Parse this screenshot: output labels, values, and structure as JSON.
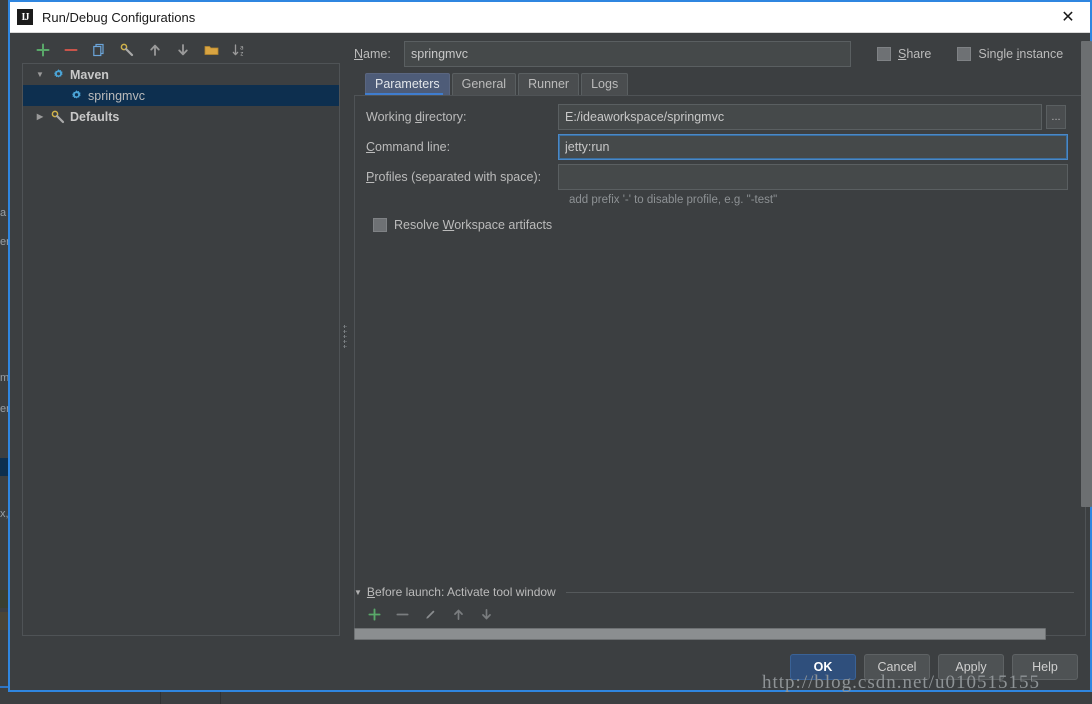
{
  "window": {
    "title": "Run/Debug Configurations",
    "app_icon": "intellij-idea-icon",
    "close_label": "✕"
  },
  "tree_toolbar": {
    "items": [
      {
        "name": "add-configuration-button",
        "icon": "plus-icon",
        "color": "#59a869"
      },
      {
        "name": "remove-configuration-button",
        "icon": "minus-icon",
        "color": "#c9544a"
      },
      {
        "name": "copy-configuration-button",
        "icon": "copy-icon",
        "color": "#6ba4d9"
      },
      {
        "name": "edit-defaults-button",
        "icon": "wrench-icon",
        "color": "#a9a9a9"
      },
      {
        "name": "move-up-button",
        "icon": "arrow-up-icon",
        "color": "#9a9a9a"
      },
      {
        "name": "move-down-button",
        "icon": "arrow-down-icon",
        "color": "#9a9a9a"
      },
      {
        "name": "create-folder-button",
        "icon": "folder-icon",
        "color": "#d9a441"
      },
      {
        "name": "sort-alphabetically-button",
        "icon": "sort-az-icon",
        "color": "#a9a9a9"
      }
    ]
  },
  "tree": {
    "nodes": [
      {
        "label": "Maven",
        "icon": "maven-gear-icon",
        "expanded": true,
        "selected": false,
        "level": 0,
        "arrow": "▼"
      },
      {
        "label": "springmvc",
        "icon": "maven-gear-icon",
        "expanded": false,
        "selected": true,
        "level": 1,
        "arrow": ""
      },
      {
        "label": "Defaults",
        "icon": "wrench-icon",
        "expanded": false,
        "selected": false,
        "level": 0,
        "arrow": "▶"
      }
    ]
  },
  "name_row": {
    "label_prefix": "",
    "label": "Name:",
    "label_mnemonic": "N",
    "label_rest": "ame:",
    "value": "springmvc",
    "share": {
      "label_mnemonic": "S",
      "label_rest": "hare",
      "label": "Share",
      "checked": false
    },
    "single_instance": {
      "label_before": "Single ",
      "label_mnemonic": "i",
      "label_rest": "nstance",
      "label": "Single instance",
      "checked": false
    }
  },
  "tabs": [
    {
      "label": "Parameters",
      "active": true
    },
    {
      "label": "General",
      "active": false
    },
    {
      "label": "Runner",
      "active": false
    },
    {
      "label": "Logs",
      "active": false
    }
  ],
  "parameters_panel": {
    "working_directory": {
      "label_before": "Working ",
      "label_mnemonic": "d",
      "label_rest": "irectory:",
      "label": "Working directory:",
      "value": "E:/ideaworkspace/springmvc",
      "browse_label": "..."
    },
    "command_line": {
      "label_mnemonic": "C",
      "label_rest": "ommand line:",
      "label": "Command line:",
      "value": "jetty:run",
      "focused": true
    },
    "profiles": {
      "label_mnemonic": "P",
      "label_rest": "rofiles (separated with space):",
      "label": "Profiles (separated with space):",
      "value": "",
      "hint": "add prefix '-' to disable profile, e.g. \"-test\""
    },
    "resolve_workspace_artifacts": {
      "label_before": "Resolve ",
      "label_mnemonic": "W",
      "label_rest": "orkspace artifacts",
      "label": "Resolve Workspace artifacts",
      "checked": false
    }
  },
  "before_launch": {
    "arrow": "▼",
    "title_mnemonic": "B",
    "title_rest": "efore launch: Activate tool window",
    "title": "Before launch: Activate tool window",
    "toolbar": [
      {
        "name": "add-task-button",
        "icon": "plus-icon",
        "color": "#59a869"
      },
      {
        "name": "remove-task-button",
        "icon": "minus-icon",
        "color": "#7a7d7f"
      },
      {
        "name": "edit-task-button",
        "icon": "pencil-icon",
        "color": "#8a8d8f"
      },
      {
        "name": "task-move-up-button",
        "icon": "arrow-up-icon",
        "color": "#7a7d7f"
      },
      {
        "name": "task-move-down-button",
        "icon": "arrow-down-icon",
        "color": "#7a7d7f"
      }
    ]
  },
  "buttons": [
    {
      "label": "OK",
      "default": true,
      "name": "ok-button"
    },
    {
      "label": "Cancel",
      "default": false,
      "name": "cancel-button"
    },
    {
      "label": "Apply",
      "default": false,
      "name": "apply-button",
      "mnemonic": "A"
    },
    {
      "label": "Help",
      "default": false,
      "name": "help-button",
      "mnemonic": "H"
    }
  ],
  "watermark": {
    "text": "http://blog.csdn.net/u010515155"
  },
  "colors": {
    "accent_blue": "#2f86e0",
    "panel_bg": "#3c3f41",
    "selection_bg": "#0d2f4f",
    "tab_active_bg": "#4e5c78",
    "default_button_bg": "#2f4f7c"
  },
  "ide_background": {
    "ghost_labels": [
      "a",
      "er",
      "m",
      "er",
      "x,"
    ]
  }
}
